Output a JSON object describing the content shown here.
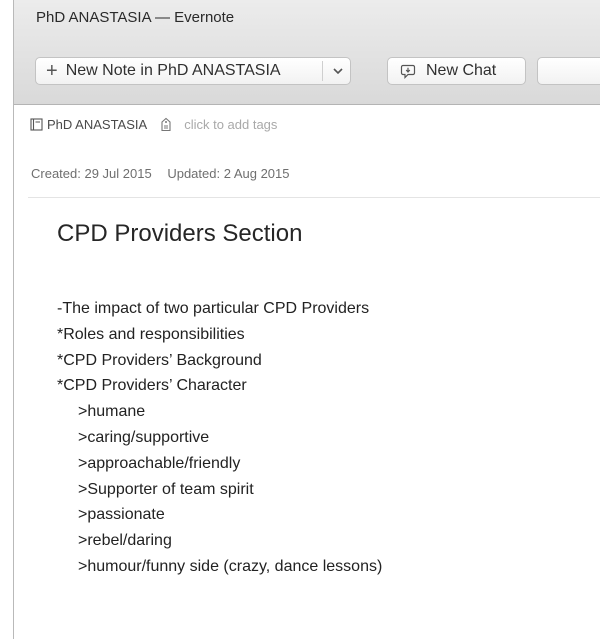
{
  "window": {
    "title": "PhD ANASTASIA — Evernote"
  },
  "toolbar": {
    "new_note_label": "New Note in PhD ANASTASIA",
    "new_chat_label": "New Chat"
  },
  "note_meta": {
    "notebook": "PhD ANASTASIA",
    "tags_placeholder": "click to add tags",
    "created": "Created: 29 Jul 2015",
    "updated": "Updated: 2 Aug 2015"
  },
  "note": {
    "title": "CPD Providers Section",
    "lines": [
      "-The impact of two particular CPD Providers",
      "*Roles and responsibilities",
      "*CPD Providers’ Background",
      "*CPD Providers’ Character",
      ">humane",
      ">caring/supportive",
      ">approachable/friendly",
      ">Supporter of team spirit",
      ">passionate",
      ">rebel/daring",
      ">humour/funny side (crazy, dance lessons)"
    ]
  },
  "icons": [
    "plus-icon",
    "chevron-down-icon",
    "chat-icon",
    "notebook-icon",
    "tag-icon"
  ]
}
